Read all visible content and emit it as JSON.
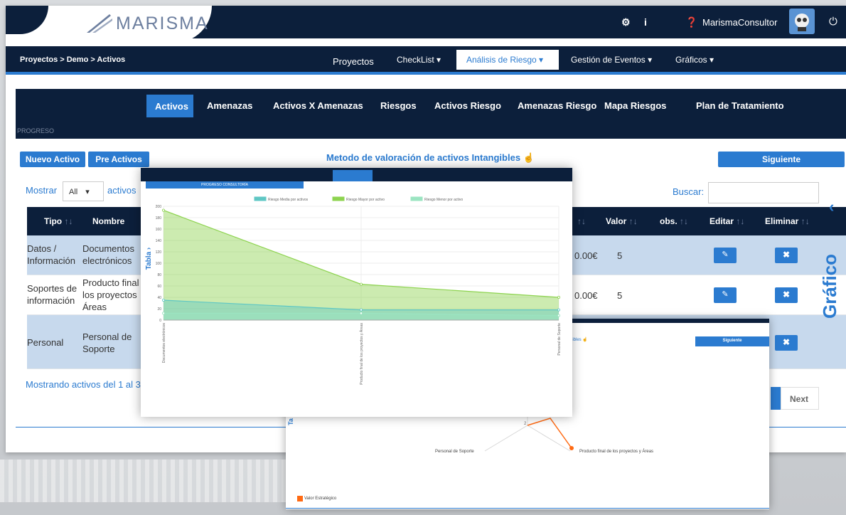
{
  "header": {
    "logo_text": "MARISMA",
    "user_name": "MarismaConsultor"
  },
  "navbar": {
    "breadcrumb": "Proyectos > Demo > Activos",
    "items": [
      "Proyectos",
      "CheckList ▾",
      "Análisis de Riesgo ▾",
      "Gestión de Eventos ▾",
      "Gráficos ▾"
    ]
  },
  "subnav": {
    "items": [
      "Activos",
      "Amenazas",
      "Activos X Amenazas",
      "Riesgos",
      "Activos Riesgo",
      "Amenazas Riesgo",
      "Mapa Riesgos",
      "Plan de Tratamiento"
    ],
    "progreso": "PROGRESO"
  },
  "toolbar": {
    "nuevo": "Nuevo Activo",
    "pre": "Pre Activos",
    "metodo": "Metodo de valoración de activos Intangibles",
    "siguiente": "Siguiente"
  },
  "table": {
    "mostrar": "Mostrar",
    "entries": "All",
    "activos": "activos",
    "buscar": "Buscar:",
    "headers": {
      "tipo": "Tipo",
      "nombre": "Nombre",
      "valor": "Valor",
      "obs": "obs.",
      "editar": "Editar",
      "eliminar": "Eliminar"
    },
    "rows": [
      {
        "tipo": "Datos / Información",
        "nombre": "Documentos electrónicos",
        "costo": "0.00€",
        "valor": "5"
      },
      {
        "tipo": "Soportes de información",
        "nombre": "Producto final los proyectos Áreas",
        "costo": "0.00€",
        "valor": "5"
      },
      {
        "tipo": "Personal",
        "nombre": "Personal de Soporte",
        "costo": "",
        "valor": ""
      }
    ],
    "mostrando": "Mostrando activos del 1 al 3",
    "next": "Next"
  },
  "side": {
    "grafico": "Gráfico"
  },
  "panel1": {
    "progreso": "PROGRESO CONSULTORÍA",
    "tabla": "Tabla ›"
  },
  "panel2": {
    "siguiente": "Siguiente",
    "gibles": "gibles",
    "label_a": "Personal de Soporte",
    "label_b": "Producto final de los proyectos y Áreas",
    "num": "2",
    "tab": "Ta",
    "legend": "Valor Estratégico"
  },
  "chart_data": {
    "type": "area",
    "categories": [
      "Documentos electrónicos",
      "Producto final de los proyectos y Áreas",
      "Personal de Soporte"
    ],
    "series": [
      {
        "name": "Riesgo Media por activos",
        "values": [
          35,
          18,
          18
        ],
        "color": "#5fc7c4"
      },
      {
        "name": "Riesgo Mayor por activo",
        "values": [
          193,
          63,
          40
        ],
        "color": "#8dd34f"
      },
      {
        "name": "Riesgo Menor por activo",
        "values": [
          12,
          12,
          8
        ],
        "color": "#9be4c1"
      }
    ],
    "ylim": [
      0,
      200
    ],
    "yticks": [
      0,
      20,
      40,
      60,
      80,
      100,
      120,
      140,
      160,
      180,
      200
    ]
  }
}
